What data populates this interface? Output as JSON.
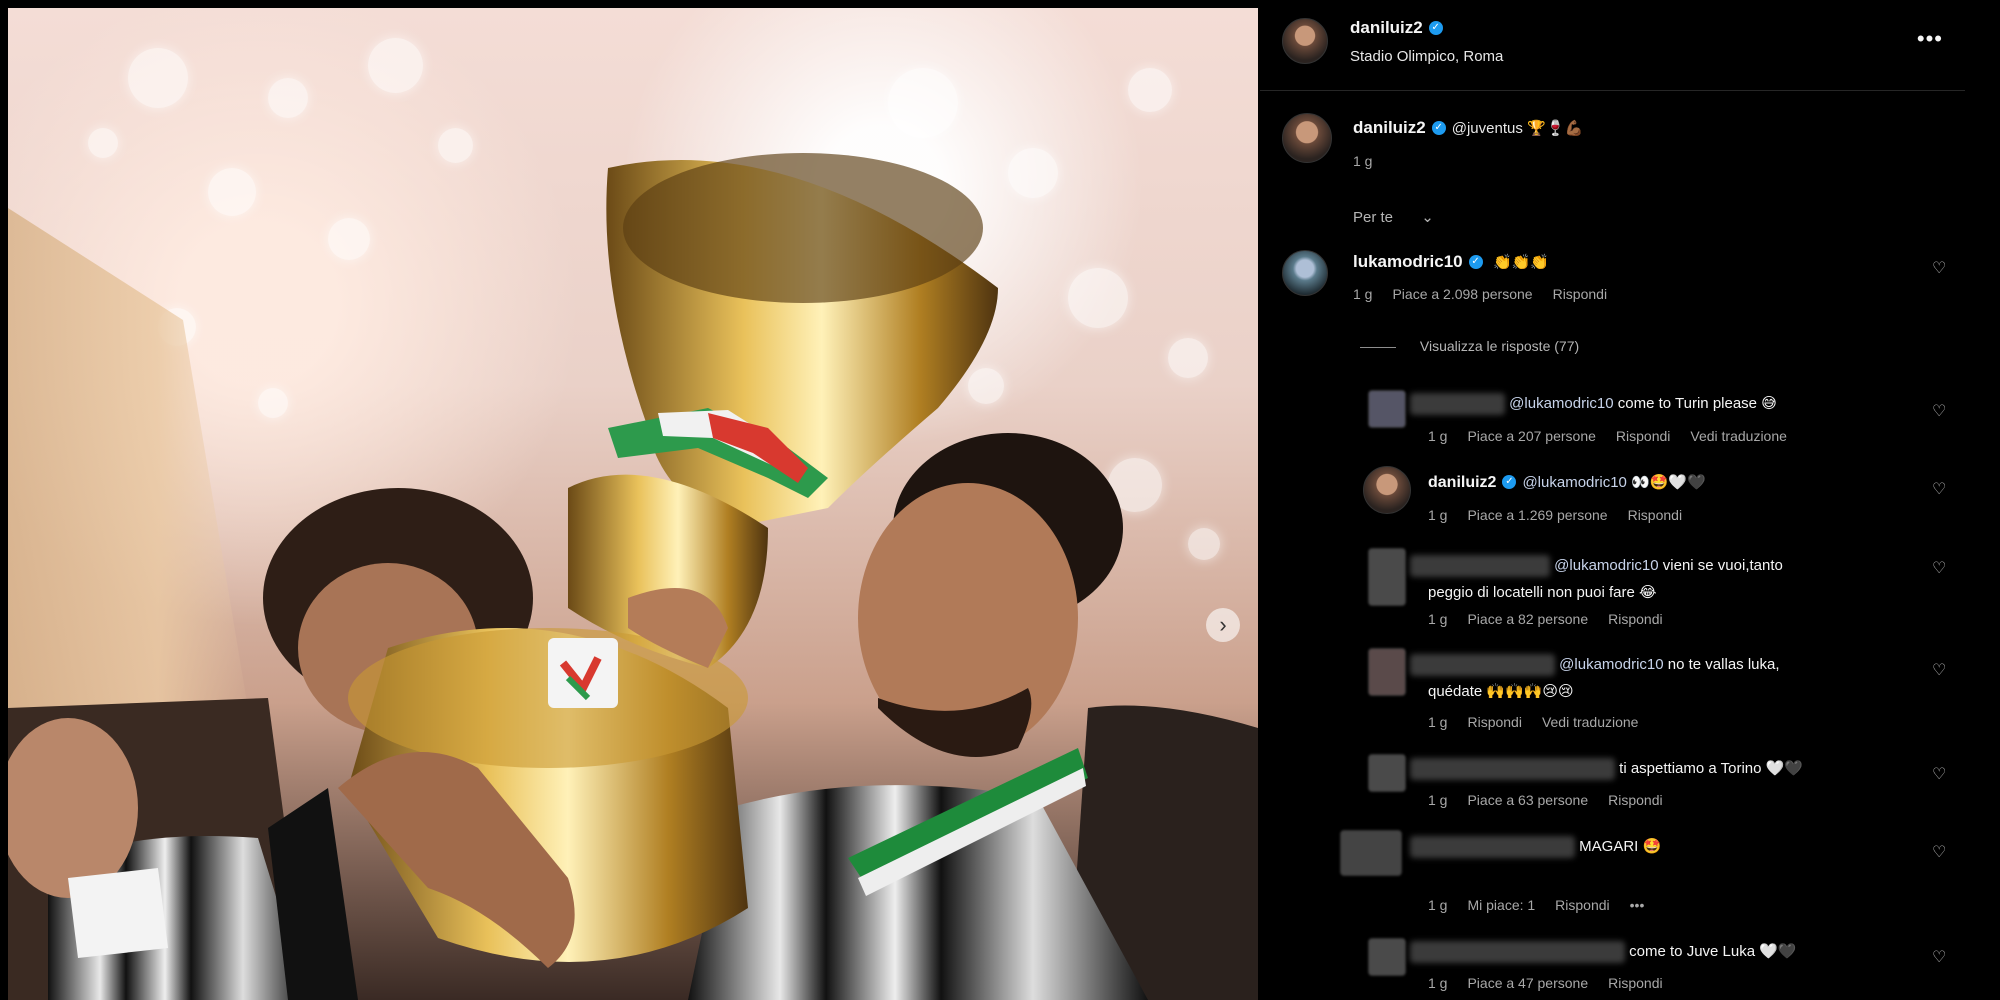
{
  "post": {
    "author": "daniluiz2",
    "location": "Stadio Olimpico, Roma",
    "caption_mention": "@juventus",
    "caption_emojis": "🏆🍷💪🏾",
    "caption_time": "1 g",
    "sort_label": "Per te",
    "more_label": "•••",
    "next_label": "›"
  },
  "comments": [
    {
      "user": "lukamodric10",
      "text": "👏👏👏",
      "time": "1 g",
      "likes": "Piace a 2.098 persone",
      "reply": "Rispondi"
    }
  ],
  "replies_toggle": "Visualizza le risposte (77)",
  "replies": [
    {
      "mention": "@lukamodric10",
      "text": "come to Turin please 😅",
      "time": "1 g",
      "likes": "Piace a 207 persone",
      "reply": "Rispondi",
      "translate": "Vedi traduzione"
    },
    {
      "user": "daniluiz2",
      "mention": "@lukamodric10",
      "text": "👀🤩🤍🖤",
      "time": "1 g",
      "likes": "Piace a 1.269 persone",
      "reply": "Rispondi"
    },
    {
      "mention": "@lukamodric10",
      "text": "vieni se vuoi,tanto",
      "text2": "peggio di locatelli non puoi fare 😂",
      "time": "1 g",
      "likes": "Piace a 82 persone",
      "reply": "Rispondi"
    },
    {
      "mention": "@lukamodric10",
      "text": "no te vallas luka,",
      "text2": "quédate 🙌🙌🙌😢😢",
      "time": "1 g",
      "reply": "Rispondi",
      "translate": "Vedi traduzione"
    },
    {
      "text": "ti aspettiamo a Torino 🤍🖤",
      "time": "1 g",
      "likes": "Piace a 63 persone",
      "reply": "Rispondi"
    },
    {
      "text": "MAGARI 🤩",
      "time": "1 g",
      "likes": "Mi piace: 1",
      "reply": "Rispondi",
      "more": "•••"
    },
    {
      "text": "come to Juve Luka 🤍🖤",
      "time": "1 g",
      "likes": "Piace a 47 persone",
      "reply": "Rispondi"
    }
  ],
  "icons": {
    "verified": "verified-badge-icon",
    "heart": "heart-outline-icon",
    "chevron": "chevron-down-icon"
  },
  "colors": {
    "background": "#000000",
    "verified": "#1d9bf0",
    "muted": "#a8a8a8",
    "mention": "#c7d3ea"
  }
}
